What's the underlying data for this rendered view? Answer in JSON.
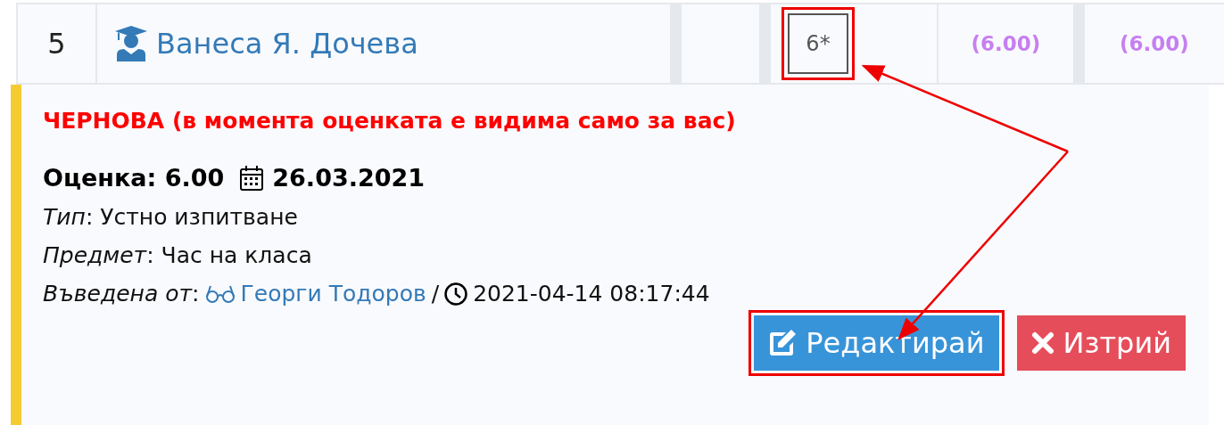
{
  "row": {
    "number": "5",
    "student": "Ванеса Я. Дочева",
    "grade": {
      "text": "6*",
      "highlighted": true
    },
    "averages": [
      "(6.00)",
      "(6.00)"
    ]
  },
  "detail": {
    "status": "ЧЕРНОВА (в момента оценката е видима само за вас)",
    "grade_label": "Оценка: 6.00",
    "date": "26.03.2021",
    "fields": [
      "*Тип*: Устно изпитване",
      "*Предмет*: Час на класа"
    ],
    "entered_by": {
      "label": "*Въведена от*:",
      "teacher": "Георги Тодоров",
      "separator": "/",
      "timestamp": "2021-04-14 08:17:44"
    },
    "buttons": [
      {
        "kind": "edit",
        "label": "Редактирай",
        "highlighted": true
      },
      {
        "kind": "delete",
        "label": "Изтрий",
        "highlighted": false
      }
    ]
  }
}
